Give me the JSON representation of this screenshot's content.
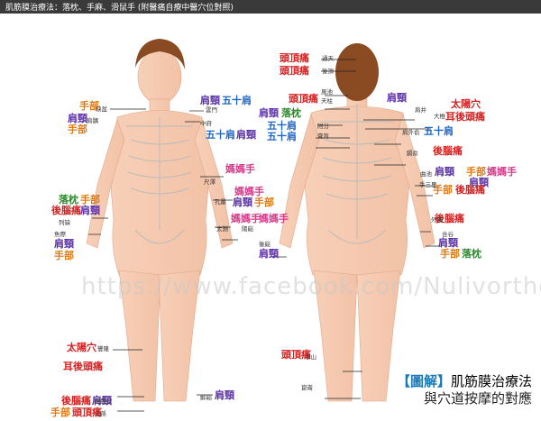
{
  "header": {
    "title": "肌筋膜治療法：落枕、手麻、滑鼠手 (附醫痛自療中醫穴位對照)"
  },
  "colors": {
    "purple": "#5a2ea6",
    "orange": "#e07a14",
    "pink": "#d63a8a",
    "green": "#2c8a2c",
    "blue": "#1f66c7",
    "red": "#d42020"
  },
  "watermark": "https://www.facebook.com/Nulivortho",
  "caption": {
    "tag": "【圖解】",
    "line1": "肌筋膜治療法",
    "line2": "與穴道按摩的對應"
  },
  "labels": [
    {
      "t": "手部",
      "c": "orange"
    },
    {
      "t": "肩頸",
      "c": "purple"
    },
    {
      "t": "手部",
      "c": "orange"
    },
    {
      "t": "肩頸",
      "c": "purple"
    },
    {
      "t": "五十肩",
      "c": "blue"
    },
    {
      "t": "五十肩",
      "c": "blue"
    },
    {
      "t": "肩頸",
      "c": "purple"
    },
    {
      "t": "媽媽手",
      "c": "pink"
    },
    {
      "t": "媽媽手",
      "c": "pink"
    },
    {
      "t": "肩頸",
      "c": "purple"
    },
    {
      "t": "手部",
      "c": "orange"
    },
    {
      "t": "媽媽手",
      "c": "pink"
    },
    {
      "t": "媽媽手",
      "c": "pink"
    },
    {
      "t": "落枕",
      "c": "green"
    },
    {
      "t": "手部",
      "c": "orange"
    },
    {
      "t": "後腦痛",
      "c": "red"
    },
    {
      "t": "肩頸",
      "c": "purple"
    },
    {
      "t": "肩頸",
      "c": "purple"
    },
    {
      "t": "手部",
      "c": "orange"
    },
    {
      "t": "太陽穴",
      "c": "red"
    },
    {
      "t": "耳後頭痛",
      "c": "red"
    },
    {
      "t": "後腦痛",
      "c": "red"
    },
    {
      "t": "肩頸",
      "c": "purple"
    },
    {
      "t": "手部",
      "c": "orange"
    },
    {
      "t": "頭頂痛",
      "c": "red"
    },
    {
      "t": "肩頸",
      "c": "purple"
    },
    {
      "t": "頭頂痛",
      "c": "red"
    },
    {
      "t": "頭頂痛",
      "c": "red"
    },
    {
      "t": "頭頂痛",
      "c": "red"
    },
    {
      "t": "肩頸",
      "c": "purple"
    },
    {
      "t": "落枕",
      "c": "green"
    },
    {
      "t": "五十肩",
      "c": "blue"
    },
    {
      "t": "五十肩",
      "c": "blue"
    },
    {
      "t": "太陽穴",
      "c": "red"
    },
    {
      "t": "耳後頭痛",
      "c": "red"
    },
    {
      "t": "肩頸",
      "c": "purple"
    },
    {
      "t": "五十肩",
      "c": "blue"
    },
    {
      "t": "後腦痛",
      "c": "red"
    },
    {
      "t": "肩頸",
      "c": "purple"
    },
    {
      "t": "手部",
      "c": "orange"
    },
    {
      "t": "媽媽手",
      "c": "pink"
    },
    {
      "t": "肩頸",
      "c": "purple"
    },
    {
      "t": "手部",
      "c": "orange"
    },
    {
      "t": "後腦痛",
      "c": "red"
    },
    {
      "t": "後腦痛",
      "c": "red"
    },
    {
      "t": "肩頸",
      "c": "purple"
    },
    {
      "t": "手部",
      "c": "orange"
    },
    {
      "t": "落枕",
      "c": "green"
    },
    {
      "t": "肩頸",
      "c": "purple"
    },
    {
      "t": "頭頂痛",
      "c": "red"
    }
  ],
  "points": [
    "缺盆",
    "肩髃",
    "雲門",
    "中府",
    "尺澤",
    "孔最",
    "列缺",
    "魚際",
    "太淵",
    "陽谿",
    "豐隆",
    "足臨泣",
    "公孫",
    "解谿",
    "通天",
    "後頂",
    "風池",
    "天柱",
    "肩井",
    "附分",
    "膏肓",
    "大椎",
    "肩外俞",
    "膈俞",
    "曲池",
    "手三里",
    "外關",
    "合谷",
    "後谿",
    "承山",
    "崑崙"
  ]
}
